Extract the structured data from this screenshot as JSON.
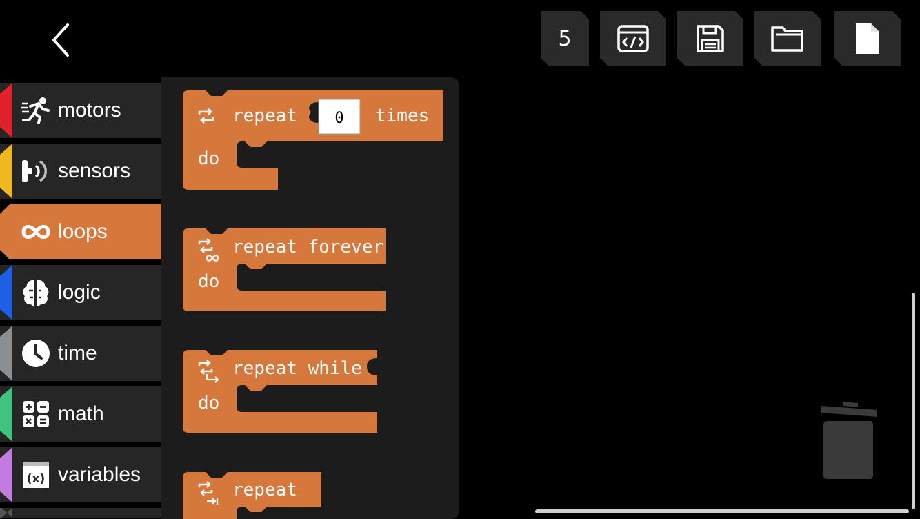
{
  "toolbar": {
    "count": "5",
    "buttons": [
      "code-icon",
      "save-icon",
      "folder-icon",
      "new-file-icon"
    ]
  },
  "categories": [
    {
      "label": "motors",
      "color": "#e0202a",
      "icon": "running-person-icon"
    },
    {
      "label": "sensors",
      "color": "#f0b820",
      "icon": "sensor-icon"
    },
    {
      "label": "loops",
      "color": "#d6783b",
      "icon": "infinity-icon",
      "active": true
    },
    {
      "label": "logic",
      "color": "#1f5fe6",
      "icon": "brain-icon"
    },
    {
      "label": "time",
      "color": "#8a8f93",
      "icon": "clock-icon"
    },
    {
      "label": "math",
      "color": "#3fc37e",
      "icon": "calculator-icon"
    },
    {
      "label": "variables",
      "color": "#c27ce0",
      "icon": "variable-icon"
    }
  ],
  "blocks": {
    "repeat_times": {
      "repeat": "repeat",
      "value": "0",
      "times": "times",
      "do": "do"
    },
    "repeat_forever": {
      "label": "repeat forever",
      "do": "do"
    },
    "repeat_while": {
      "label": "repeat while",
      "do": "do"
    },
    "repeat_4": {
      "label": "repeat"
    }
  },
  "colors": {
    "block": "#d6783b",
    "panel": "#1c1c1c",
    "category_bg": "#262626"
  }
}
